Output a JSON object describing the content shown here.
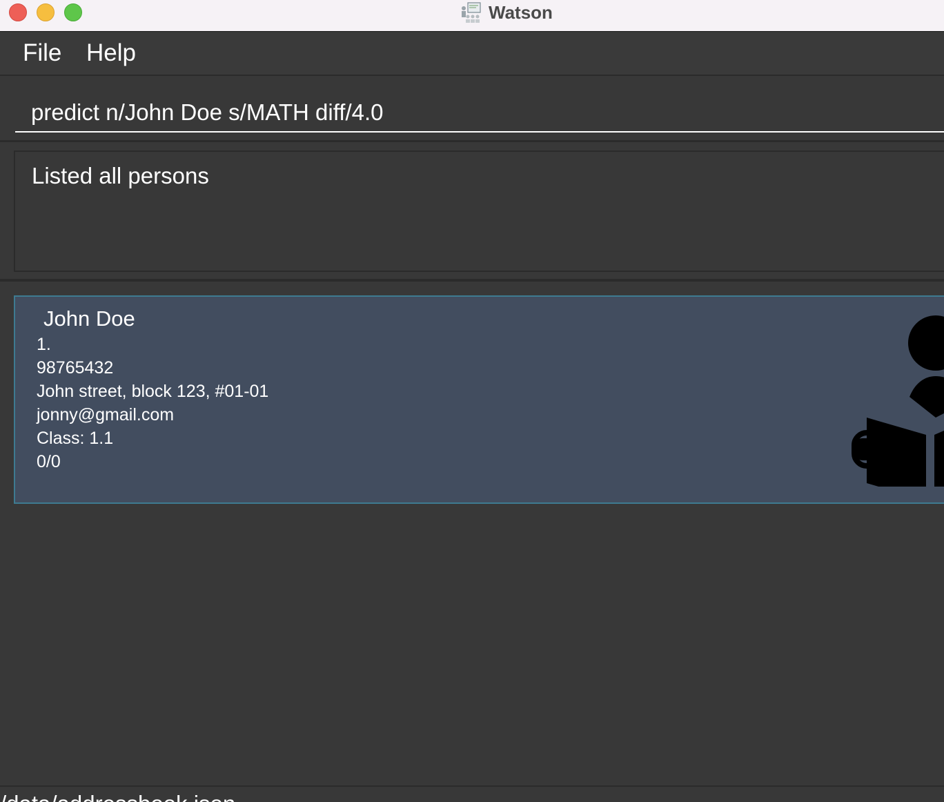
{
  "window": {
    "title": "Watson",
    "app_icon": "classroom-icon",
    "controls": [
      "close",
      "minimize",
      "maximize"
    ]
  },
  "menu": {
    "items": [
      {
        "label": "File"
      },
      {
        "label": "Help"
      }
    ]
  },
  "command": {
    "value": "predict n/John Doe s/MATH diff/4.0"
  },
  "result": {
    "text": "Listed all persons"
  },
  "persons": [
    {
      "name": "John Doe",
      "index": "1.",
      "phone": "98765432",
      "address": "John street, block 123, #01-01",
      "email": "jonny@gmail.com",
      "class": "Class: 1.1",
      "score": "0/0",
      "icon": "student-reading-icon",
      "selected": true
    }
  ],
  "status": {
    "path": "/data/addressbook.json"
  },
  "colors": {
    "background": "#383838",
    "card": "#424d5f",
    "card_border": "#3e7b91",
    "text": "#ffffff"
  }
}
